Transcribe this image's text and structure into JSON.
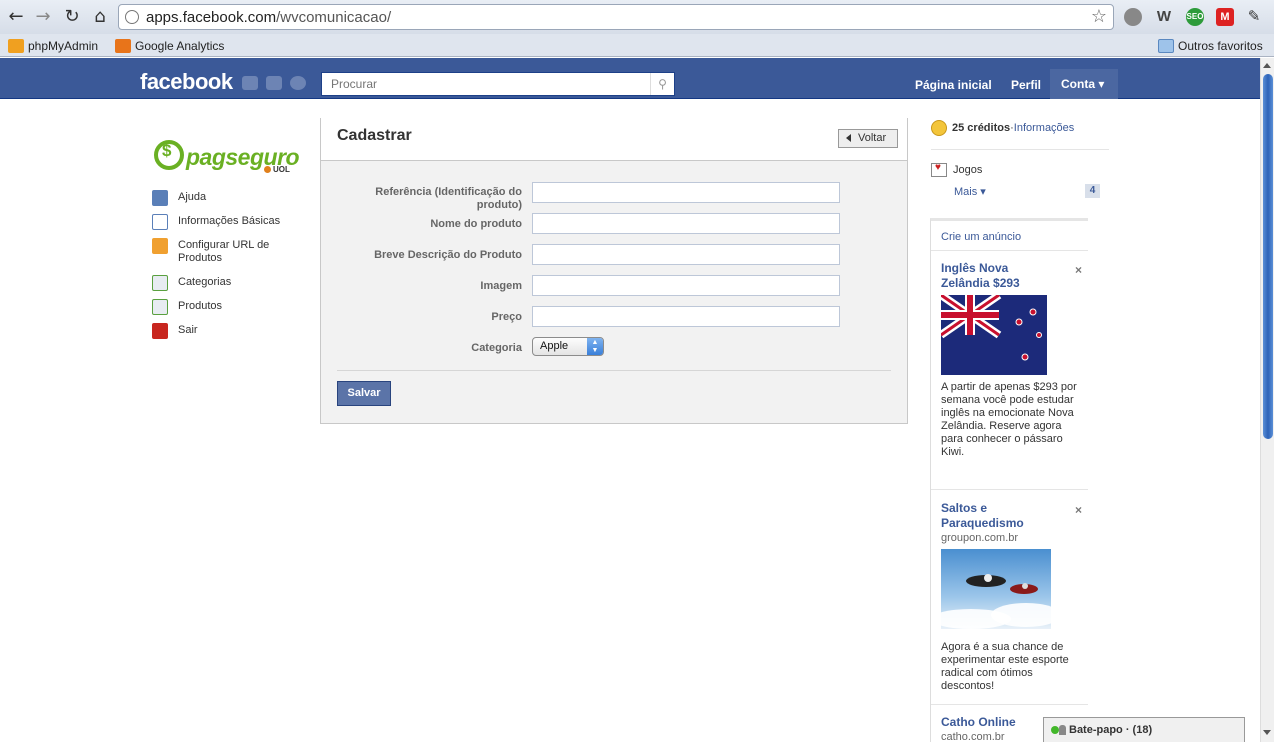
{
  "browser": {
    "url_host": "apps.facebook.com",
    "url_path": "/wvcomunicacao/",
    "bookmarks": [
      {
        "label": "phpMyAdmin"
      },
      {
        "label": "Google Analytics"
      }
    ],
    "other_bookmarks": "Outros favoritos"
  },
  "fb_header": {
    "logo": "facebook",
    "search_placeholder": "Procurar",
    "nav": {
      "home": "Página inicial",
      "profile": "Perfil",
      "account": "Conta ▾"
    }
  },
  "sidebar": {
    "items": [
      {
        "label": "Ajuda"
      },
      {
        "label": "Informações Básicas"
      },
      {
        "label": "Configurar URL de Produtos"
      },
      {
        "label": "Categorias"
      },
      {
        "label": "Produtos"
      },
      {
        "label": "Sair"
      }
    ]
  },
  "form": {
    "title": "Cadastrar",
    "back_label": "Voltar",
    "fields": [
      {
        "label": "Referência (Identificação do produto)"
      },
      {
        "label": "Nome do produto"
      },
      {
        "label": "Breve Descrição do Produto"
      },
      {
        "label": "Imagem"
      },
      {
        "label": "Preço"
      }
    ],
    "category_label": "Categoria",
    "category_value": "Apple",
    "save_label": "Salvar"
  },
  "right": {
    "credits_amount": "25 créditos",
    "credits_sep": " · ",
    "credits_link": "Informações",
    "games_label": "Jogos",
    "more_label": "Mais ▾",
    "more_count": "4",
    "create_ad": "Crie um anúncio",
    "ads": [
      {
        "title": "Inglês Nova Zelândia $293",
        "body": "A partir de apenas $293 por semana você pode estudar inglês na emocionate Nova Zelândia. Reserve agora para conhecer o pássaro Kiwi."
      },
      {
        "title": "Saltos e Paraquedismo",
        "domain": "groupon.com.br",
        "body": "Agora é a sua chance de experimentar este esporte radical com ótimos descontos!"
      },
      {
        "title": "Catho Online",
        "domain": "catho.com.br"
      }
    ]
  },
  "chat": {
    "label": "Bate-papo · (18)"
  },
  "colors": {
    "fb_blue": "#3b5998",
    "pagseguro_green": "#6ab023"
  }
}
